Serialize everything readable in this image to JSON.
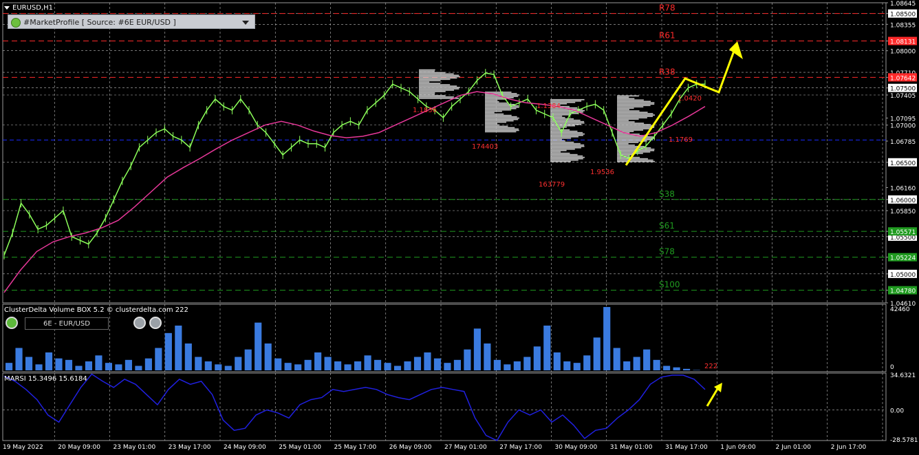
{
  "header": {
    "symbol_title": "EURUSD,H1",
    "market_profile_label": "#MarketProfile [ Source: #6E EUR/USD ]",
    "clusterdelta_title": "ClusterDelta Volume BOX 5.2 © clusterdelta.com 222",
    "clusterdelta_symbol": "6E - EUR/USD",
    "marsi_title": "MARSI 15.3496 15.6184"
  },
  "colors": {
    "background": "#000000",
    "grid": "#c0c0c0",
    "candle": "#8cff5a",
    "ma": "#e8389a",
    "profile": "#bdbdbd",
    "volume": "#3a7be0",
    "marsi": "#2020e0",
    "arrow": "#ffff00",
    "resistance": "#ff2a2a",
    "support": "#1f9a1f",
    "pivot_blue": "#1a2bff"
  },
  "chart_data": [
    {
      "type": "line",
      "name": "price",
      "title": "EURUSD,H1",
      "x": [
        "19 May 2022",
        "20 May 09:00",
        "23 May 01:00",
        "23 May 17:00",
        "24 May 09:00",
        "25 May 01:00",
        "25 May 17:00",
        "26 May 09:00",
        "27 May 01:00",
        "27 May 17:00",
        "30 May 09:00",
        "31 May 01:00",
        "31 May 17:00",
        "1 Jun 09:00",
        "2 Jun 01:00",
        "2 Jun 17:00"
      ],
      "y_axis_ticks": [
        "1.08645",
        "1.08500",
        "1.08355",
        "1.08000",
        "1.07710",
        "1.07500",
        "1.07405",
        "1.07095",
        "1.07000",
        "1.06785",
        "1.06500",
        "1.06160",
        "1.06000",
        "1.05850",
        "1.05500",
        "1.05000",
        "1.04610"
      ],
      "highlighted_prices": [
        "1.08131",
        "1.07642",
        "1.05571",
        "1.05224",
        "1.04780"
      ],
      "ylim": [
        1.0461,
        1.08645
      ],
      "close": [
        1.0525,
        1.0555,
        1.0595,
        1.058,
        1.056,
        1.0565,
        1.0575,
        1.0585,
        1.055,
        1.0545,
        1.054,
        1.0555,
        1.0575,
        1.06,
        1.0625,
        1.0645,
        1.067,
        1.068,
        1.069,
        1.0695,
        1.0685,
        1.068,
        1.067,
        1.07,
        1.072,
        1.0735,
        1.0725,
        1.072,
        1.0735,
        1.072,
        1.07,
        1.069,
        1.0675,
        1.066,
        1.067,
        1.068,
        1.0675,
        1.0675,
        1.067,
        1.069,
        1.07,
        1.0705,
        1.07,
        1.072,
        1.073,
        1.074,
        1.0755,
        1.075,
        1.0745,
        1.0735,
        1.0725,
        1.072,
        1.071,
        1.0725,
        1.0735,
        1.0745,
        1.076,
        1.077,
        1.0768,
        1.074,
        1.0725,
        1.073,
        1.0735,
        1.072,
        1.0715,
        1.071,
        1.069,
        1.0715,
        1.072,
        1.0725,
        1.0728,
        1.072,
        1.069,
        1.066,
        1.0655,
        1.0665,
        1.0672,
        1.0685,
        1.07,
        1.0715,
        1.0735,
        1.075,
        1.0755,
        1.0755
      ],
      "moving_average": [
        1.0475,
        1.0505,
        1.053,
        1.0543,
        1.055,
        1.0555,
        1.0562,
        1.0572,
        1.059,
        1.061,
        1.063,
        1.0643,
        1.0655,
        1.0668,
        1.068,
        1.069,
        1.07,
        1.0705,
        1.07,
        1.0692,
        1.0686,
        1.0683,
        1.0685,
        1.069,
        1.07,
        1.071,
        1.072,
        1.073,
        1.074,
        1.0745,
        1.0742,
        1.0735,
        1.073,
        1.0728,
        1.0725,
        1.072,
        1.071,
        1.07,
        1.069,
        1.0685,
        1.069,
        1.07,
        1.0712,
        1.0725
      ],
      "levels": [
        {
          "label": "R78",
          "value": 1.085,
          "color": "#ff2a2a"
        },
        {
          "label": "R61",
          "value": 1.08131,
          "color": "#ff2a2a"
        },
        {
          "label": "R38",
          "value": 1.07642,
          "color": "#ff2a2a"
        },
        {
          "label": "S38",
          "value": 1.06,
          "color": "#1f9a1f"
        },
        {
          "label": "S61",
          "value": 1.05571,
          "color": "#1f9a1f"
        },
        {
          "label": "S78",
          "value": 1.05224,
          "color": "#1f9a1f"
        },
        {
          "label": "S100",
          "value": 1.0478,
          "color": "#1f9a1f"
        }
      ],
      "profile_labels": [
        "1.1836",
        "174403",
        "1.1384",
        "163779",
        "1.9536",
        "1.0420",
        "1.1769"
      ]
    },
    {
      "type": "bar",
      "name": "volume",
      "title": "ClusterDelta Volume BOX 5.2 © clusterdelta.com 222",
      "ylim": [
        0,
        42460
      ],
      "y_axis_ticks": [
        "42460",
        "0"
      ],
      "last_value_label": "222",
      "values": [
        5000,
        15000,
        9000,
        4000,
        12000,
        8000,
        7000,
        3000,
        6000,
        10000,
        5000,
        4000,
        7000,
        3000,
        8000,
        15000,
        25000,
        30000,
        18000,
        9000,
        6000,
        4000,
        3000,
        9000,
        14000,
        32000,
        18000,
        8000,
        5000,
        4000,
        7000,
        12000,
        9000,
        6000,
        4000,
        6000,
        10000,
        7000,
        5000,
        3000,
        6000,
        9000,
        12000,
        8000,
        5000,
        7000,
        14000,
        28000,
        18000,
        7000,
        4000,
        6000,
        9000,
        16000,
        30000,
        12000,
        6000,
        5000,
        10000,
        22000,
        42460,
        15000,
        6000,
        9000,
        14000,
        7000,
        3000,
        2000,
        1000,
        222
      ]
    },
    {
      "type": "line",
      "name": "MARSI",
      "title": "MARSI 15.3496 15.6184",
      "ylim": [
        -30,
        36
      ],
      "y_axis_ticks": [
        "34.6321",
        "0.00",
        "-28.5781"
      ],
      "values": [
        33,
        28,
        20,
        10,
        -5,
        -12,
        5,
        22,
        35,
        28,
        22,
        30,
        25,
        15,
        5,
        20,
        30,
        25,
        28,
        15,
        -10,
        -20,
        -18,
        -5,
        0,
        -3,
        -8,
        5,
        10,
        12,
        20,
        18,
        20,
        22,
        20,
        15,
        12,
        10,
        15,
        20,
        22,
        20,
        18,
        -8,
        -25,
        -30,
        -12,
        0,
        -5,
        0,
        -12,
        -5,
        -15,
        -28,
        -20,
        -18,
        -8,
        0,
        10,
        25,
        32,
        34,
        34,
        30,
        20
      ]
    }
  ]
}
